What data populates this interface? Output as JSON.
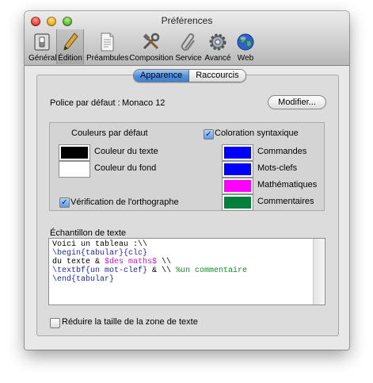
{
  "window": {
    "title": "Préférences"
  },
  "toolbar": {
    "items": [
      {
        "label": "Général",
        "icon": "general-switch-icon",
        "selected": false
      },
      {
        "label": "Édition",
        "icon": "pen-icon",
        "selected": true
      },
      {
        "label": "Préambules",
        "icon": "document-icon",
        "selected": false
      },
      {
        "label": "Composition",
        "icon": "tools-icon",
        "selected": false
      },
      {
        "label": "Service",
        "icon": "paperclip-icon",
        "selected": false
      },
      {
        "label": "Avancé",
        "icon": "gear-icon",
        "selected": false
      },
      {
        "label": "Web",
        "icon": "globe-icon",
        "selected": false
      }
    ]
  },
  "tabs": {
    "active": "Apparence",
    "other": "Raccourcis"
  },
  "font": {
    "label": "Police par défaut :",
    "value": "Monaco 12",
    "button": "Modifier..."
  },
  "colors": {
    "defaults_label": "Couleurs par défaut",
    "text_color_label": "Couleur du texte",
    "background_color_label": "Couleur du fond",
    "text_color": "#000000",
    "background_color": "#ffffff",
    "spellcheck_label": "Vérification de l'orthographe",
    "spellcheck_checked": true,
    "syntax_label": "Coloration syntaxique",
    "syntax_checked": true,
    "syntax_items": [
      {
        "label": "Commandes",
        "color": "#0000ff"
      },
      {
        "label": "Mots-clefs",
        "color": "#0000ff"
      },
      {
        "label": "Mathématiques",
        "color": "#ff00ff"
      },
      {
        "label": "Commentaires",
        "color": "#00803a"
      }
    ]
  },
  "sample": {
    "label": "Échantillon de texte",
    "line1": "Voici un tableau :\\\\",
    "line2": "\\begin{tabular}{clc}",
    "line3_text": "du texte & ",
    "line3_math": "$des maths$",
    "line3_end": " \\\\",
    "line4_cmd": "\\textbf{un mot-clef}",
    "line4_mid": " & \\\\ ",
    "line4_comment": "%un commentaire",
    "line5": "\\end{tabular}"
  },
  "reduce": {
    "label": "Réduire la taille de la zone de texte",
    "checked": false
  }
}
